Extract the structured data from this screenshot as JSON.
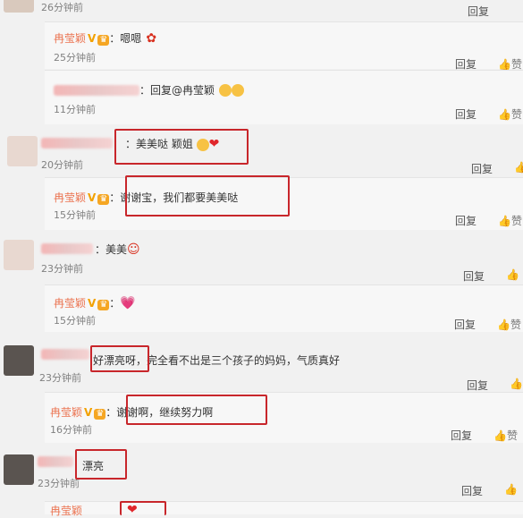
{
  "c0": {
    "time": "26分钟前",
    "reply": "回复"
  },
  "r1": {
    "name": "冉莹颖",
    "badge": "V",
    "text": "：嗯嗯",
    "time": "25分钟前",
    "reply": "回复",
    "like": "赞"
  },
  "r2": {
    "text": "：回复@冉莹颖",
    "time": "11分钟前",
    "reply": "回复",
    "like": "赞"
  },
  "c3": {
    "name": "二*** /27364",
    "text": "：美美哒 颖姐",
    "time": "20分钟前",
    "reply": "回复",
    "like": "赞"
  },
  "r4": {
    "name": "冉莹颖",
    "badge": "V",
    "text": "：谢谢宝，我们都要美美哒",
    "time": "15分钟前",
    "reply": "回复",
    "like": "赞"
  },
  "c5": {
    "text": "：美美",
    "time": "23分钟前",
    "reply": "回复",
    "like": "赞"
  },
  "r6": {
    "name": "冉莹颖",
    "badge": "V",
    "text": "：",
    "time": "15分钟前",
    "reply": "回复",
    "like": "赞"
  },
  "c7": {
    "text_a": "好漂亮呀",
    "text_b": "，完全看不出是三个孩子的妈妈，气质真好",
    "time": "23分钟前",
    "reply": "回复",
    "like": "赞"
  },
  "r8": {
    "name": "冉莹颖",
    "badge": "V",
    "text": "：谢谢啊，继续努力啊",
    "time": "16分钟前",
    "reply": "回复",
    "like": "赞"
  },
  "c9": {
    "text": "漂亮",
    "time": "23分钟前",
    "reply": "回复",
    "like": "赞"
  },
  "r10": {
    "name": "冉莹颖"
  }
}
